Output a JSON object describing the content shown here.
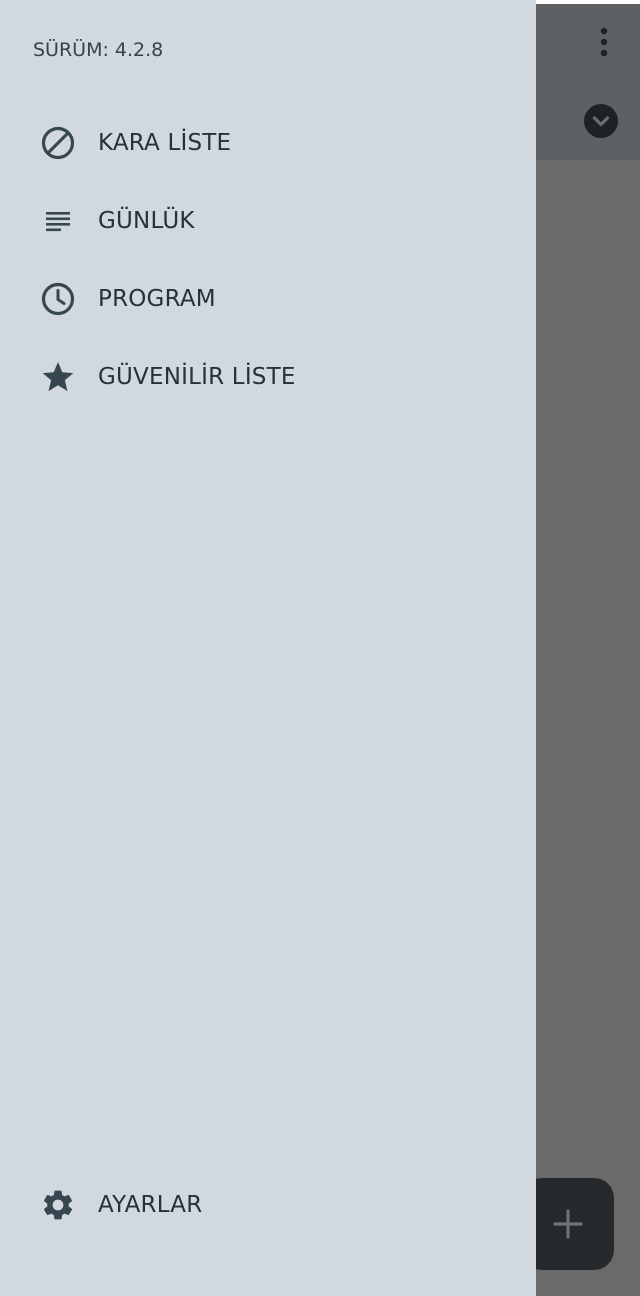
{
  "drawer": {
    "version": "SÜRÜM: 4.2.8",
    "items": [
      {
        "label": "KARA LİSTE",
        "icon": "block-icon"
      },
      {
        "label": "GÜNLÜK",
        "icon": "list-icon"
      },
      {
        "label": "PROGRAM",
        "icon": "clock-icon"
      },
      {
        "label": "GÜVENİLİR LİSTE",
        "icon": "star-icon"
      }
    ],
    "settings": {
      "label": "AYARLAR",
      "icon": "gear-icon"
    }
  },
  "colors": {
    "drawer_bg": "#d1d9df",
    "text": "#263238",
    "icon": "#37474f",
    "scrim": "#6a6a6a",
    "toolbar": "#5e6164",
    "fab": "#26292c"
  }
}
